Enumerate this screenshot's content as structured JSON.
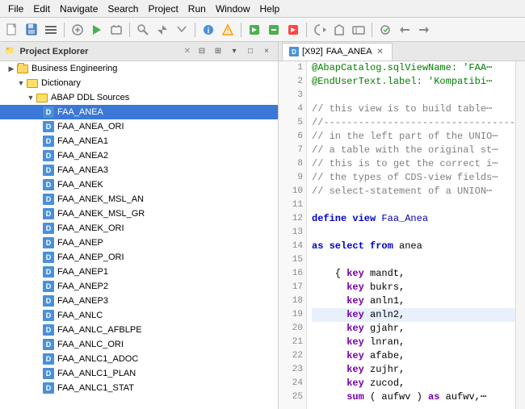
{
  "menu": {
    "items": [
      "File",
      "Edit",
      "Navigate",
      "Search",
      "Project",
      "Run",
      "Window",
      "Help"
    ]
  },
  "explorer": {
    "title": "Project Explorer",
    "close_label": "×",
    "tree": {
      "business_engineering": "Business Engineering",
      "dictionary": "Dictionary",
      "abap_ddl": "ABAP DDL Sources",
      "items": [
        "FAA_ANEA",
        "FAA_ANEA_ORI",
        "FAA_ANEA1",
        "FAA_ANEA2",
        "FAA_ANEA3",
        "FAA_ANEK",
        "FAA_ANEK_MSL_AN",
        "FAA_ANEK_MSL_GR",
        "FAA_ANEK_ORI",
        "FAA_ANEP",
        "FAA_ANEP_ORI",
        "FAA_ANEP1",
        "FAA_ANEP2",
        "FAA_ANEP3",
        "FAA_ANLC",
        "FAA_ANLC_AFBLPE",
        "FAA_ANLC_ORI",
        "FAA_ANLC1_ADOC",
        "FAA_ANLC1_PLAN",
        "FAA_ANLC1_STAT"
      ]
    }
  },
  "editor": {
    "tab_prefix": "D",
    "tab_context": "[X92]",
    "tab_name": "FAA_ANEA",
    "lines": [
      {
        "num": 1,
        "code": "@AbapCatalog.sqlViewName: 'FAA⋯",
        "type": "annotation"
      },
      {
        "num": 2,
        "code": "@EndUserText.label: 'Kompatibi⋯",
        "type": "annotation"
      },
      {
        "num": 3,
        "code": "",
        "type": "blank"
      },
      {
        "num": 4,
        "code": "// this view is to build table⋯",
        "type": "comment"
      },
      {
        "num": 5,
        "code": "//----------------------------------------⋯",
        "type": "comment"
      },
      {
        "num": 6,
        "code": "// in the left part of the UNIO⋯",
        "type": "comment"
      },
      {
        "num": 7,
        "code": "// a table with the original st⋯",
        "type": "comment"
      },
      {
        "num": 8,
        "code": "// this is to get the correct i⋯",
        "type": "comment"
      },
      {
        "num": 9,
        "code": "// the types of CDS-view fields⋯",
        "type": "comment"
      },
      {
        "num": 10,
        "code": "// select-statement of a UNION⋯",
        "type": "comment"
      },
      {
        "num": 11,
        "code": "",
        "type": "blank"
      },
      {
        "num": 12,
        "code": "define view Faa_Anea",
        "type": "define"
      },
      {
        "num": 13,
        "code": "",
        "type": "blank"
      },
      {
        "num": 14,
        "code": "as select from anea",
        "type": "select"
      },
      {
        "num": 15,
        "code": "",
        "type": "blank"
      },
      {
        "num": 16,
        "code": "    { key mandt,",
        "type": "code"
      },
      {
        "num": 17,
        "code": "      key bukrs,",
        "type": "code"
      },
      {
        "num": 18,
        "code": "      key anln1,",
        "type": "code"
      },
      {
        "num": 19,
        "code": "      key anln2,",
        "type": "code_highlighted"
      },
      {
        "num": 20,
        "code": "      key gjahr,",
        "type": "code"
      },
      {
        "num": 21,
        "code": "      key lnran,",
        "type": "code"
      },
      {
        "num": 22,
        "code": "      key afabe,",
        "type": "code"
      },
      {
        "num": 23,
        "code": "      key zujhr,",
        "type": "code"
      },
      {
        "num": 24,
        "code": "      key zucod,",
        "type": "code"
      },
      {
        "num": 25,
        "code": "      sum ( aufwv ) as aufwv,⋯",
        "type": "code"
      }
    ]
  }
}
